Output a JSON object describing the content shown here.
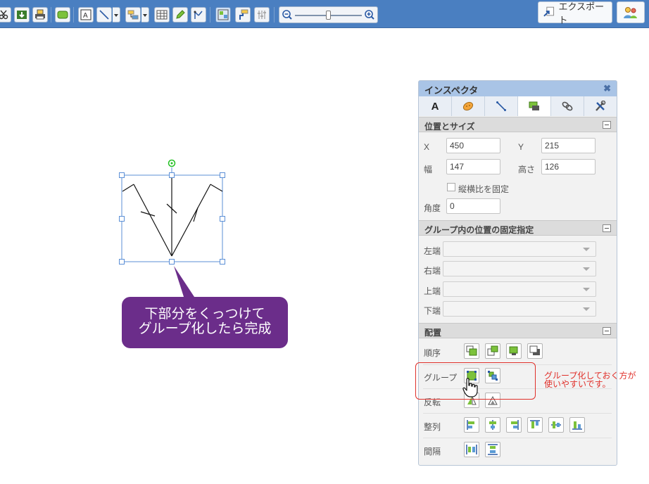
{
  "toolbar": {
    "export_label": "エクスポート",
    "zoom_level": 0.5
  },
  "callout": {
    "line1": "下部分をくっつけて",
    "line2": "グループ化したら完成"
  },
  "inspector": {
    "title": "インスペクタ",
    "close_glyph": "✖",
    "tab_text_label": "A",
    "position_size": {
      "header": "位置とサイズ",
      "x_label": "X",
      "x_value": "450",
      "y_label": "Y",
      "y_value": "215",
      "width_label": "幅",
      "width_value": "147",
      "height_label": "高さ",
      "height_value": "126",
      "lock_ratio_label": "縦横比を固定",
      "angle_label": "角度",
      "angle_value": "0"
    },
    "group_pin": {
      "header": "グループ内の位置の固定指定",
      "left_label": "左端",
      "right_label": "右端",
      "top_label": "上端",
      "bottom_label": "下端"
    },
    "arrange": {
      "header": "配置",
      "order_label": "順序",
      "group_label": "グループ",
      "flip_label": "反転",
      "align_label": "整列",
      "spacing_label": "間隔"
    }
  },
  "annotation": {
    "note": "グループ化しておく方が\n使いやすいです。"
  },
  "colors": {
    "toolbar_bg": "#4a7fc1",
    "callout_bg": "#6b2d8a",
    "highlight": "#e0302a",
    "selection": "#5b8fd6"
  }
}
